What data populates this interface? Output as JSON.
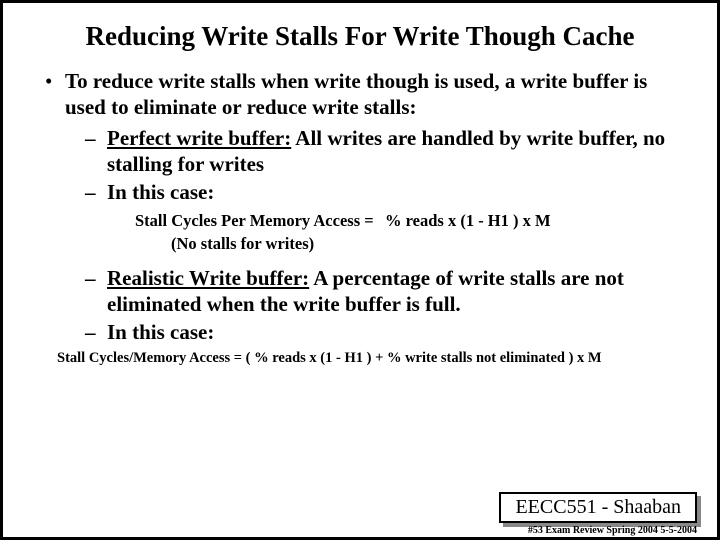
{
  "title": "Reducing Write Stalls For Write Though Cache",
  "bullet": "•",
  "dash": "–",
  "l1": "To reduce write stalls when write though is used,  a write buffer is used to eliminate or reduce write stalls:",
  "pwb_label": "Perfect write buffer:",
  "pwb_rest": "  All writes are handled by write buffer, no stalling for writes",
  "case_label": "In this case:",
  "formula1_left": "Stall Cycles Per Memory Access =",
  "formula1_right": "% reads x (1 -  H1 ) x M",
  "formula1_note": "(No stalls for writes)",
  "rwb_label": "Realistic Write buffer:",
  "rwb_rest": "  A percentage of write stalls are not eliminated  when the write buffer is full.",
  "formula2": "Stall Cycles/Memory Access =  ( % reads x (1 -  H1 )  + % write stalls not eliminated )  x M",
  "footer": "EECC551 - Shaaban",
  "subfooter": "#53   Exam Review  Spring 2004  5-5-2004"
}
